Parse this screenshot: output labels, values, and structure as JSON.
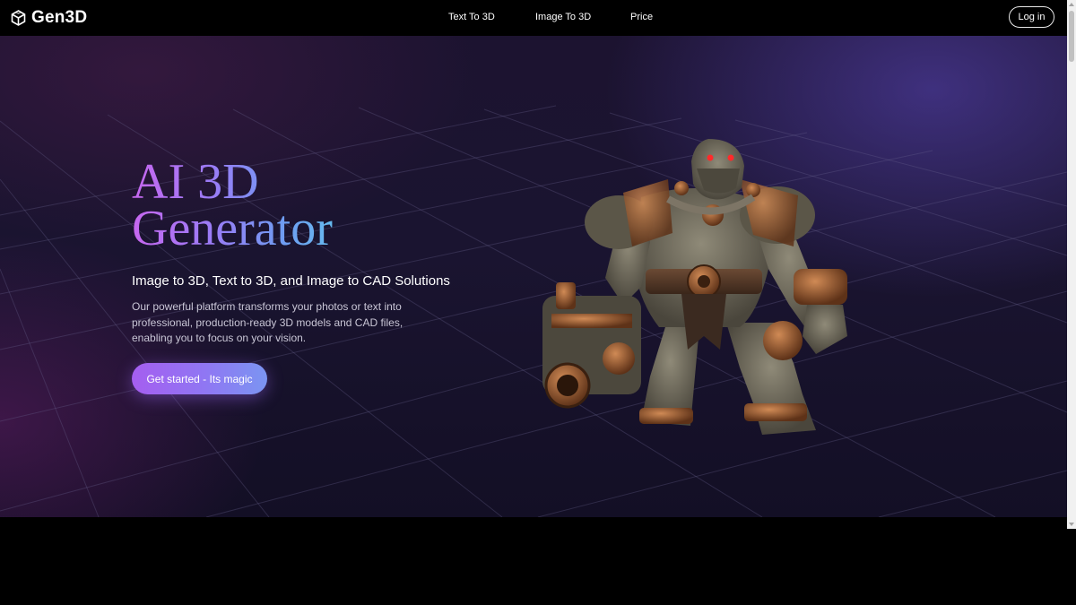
{
  "brand": {
    "name": "Gen3D",
    "logo_icon": "cube-logo-icon"
  },
  "nav": {
    "links": [
      {
        "label": "Text To 3D"
      },
      {
        "label": "Image To 3D"
      },
      {
        "label": "Price"
      }
    ],
    "login_label": "Log in"
  },
  "hero": {
    "title_line1": "AI 3D",
    "title_line2": "Generator",
    "subtitle": "Image to 3D, Text to 3D, and Image to CAD Solutions",
    "description": "Our powerful platform transforms your photos or text into professional, production-ready 3D models and CAD files, enabling you to focus on your vision.",
    "cta_label": "Get started - Its magic",
    "model_image": "steampunk-ogre-3d-model"
  },
  "colors": {
    "accent_purple": "#a55ef0",
    "accent_blue": "#7b95f2",
    "title_gradient_start": "#c767ef",
    "title_gradient_end": "#66b9ee",
    "hero_background": "#1a1430",
    "navbar_background": "#000000"
  }
}
